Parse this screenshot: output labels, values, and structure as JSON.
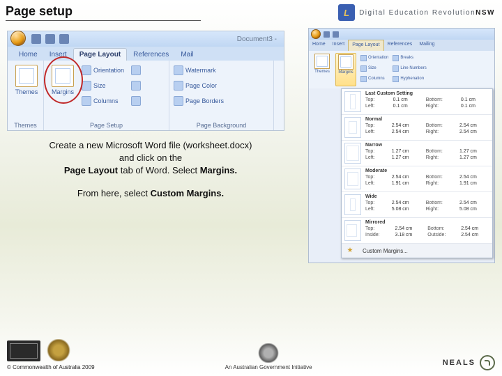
{
  "slide": {
    "title": "Page setup"
  },
  "brand": {
    "badge": "L",
    "text_plain": "Digital Education Revolution",
    "text_bold": "NSW"
  },
  "ribbon1": {
    "doc_title": "Document3 -",
    "tabs": {
      "home": "Home",
      "insert": "Insert",
      "page_layout": "Page Layout",
      "references": "References",
      "mailings": "Mail"
    },
    "themes_group": {
      "themes_btn": "Themes",
      "label": "Themes"
    },
    "page_setup_group": {
      "margins_btn": "Margins",
      "orientation": "Orientation",
      "size": "Size",
      "columns": "Columns",
      "label": "Page Setup"
    },
    "page_background_group": {
      "watermark": "Watermark",
      "page_color": "Page Color",
      "page_borders": "Page Borders",
      "label": "Page Background"
    }
  },
  "instructions": {
    "line1a": "Create a new Microsoft Word file (worksheet.docx)",
    "line1b": "and click on the",
    "line2a": "Page Layout",
    "line2b": " tab of Word. Select ",
    "line2c": "Margins.",
    "line3a": "From here, select ",
    "line3b": "Custom Margins."
  },
  "ribbon2": {
    "tabs": {
      "home": "Home",
      "insert": "Insert",
      "page_layout": "Page Layout",
      "references": "References",
      "mailings": "Mailing"
    },
    "themes_btn": "Themes",
    "margins_btn": "Margins",
    "orientation": "Orientation",
    "size": "Size",
    "columns": "Columns",
    "breaks": "Breaks",
    "line_numbers": "Line Numbers",
    "hyphenation": "Hyphenation"
  },
  "margins_menu": {
    "last": {
      "name": "Last Custom Setting",
      "top_l": "Top:",
      "top_v": "0.1 cm",
      "bot_l": "Bottom:",
      "bot_v": "0.1 cm",
      "left_l": "Left:",
      "left_v": "0.1 cm",
      "right_l": "Right:",
      "right_v": "0.1 cm"
    },
    "normal": {
      "name": "Normal",
      "top_l": "Top:",
      "top_v": "2.54 cm",
      "bot_l": "Bottom:",
      "bot_v": "2.54 cm",
      "left_l": "Left:",
      "left_v": "2.54 cm",
      "right_l": "Right:",
      "right_v": "2.54 cm"
    },
    "narrow": {
      "name": "Narrow",
      "top_l": "Top:",
      "top_v": "1.27 cm",
      "bot_l": "Bottom:",
      "bot_v": "1.27 cm",
      "left_l": "Left:",
      "left_v": "1.27 cm",
      "right_l": "Right:",
      "right_v": "1.27 cm"
    },
    "moderate": {
      "name": "Moderate",
      "top_l": "Top:",
      "top_v": "2.54 cm",
      "bot_l": "Bottom:",
      "bot_v": "2.54 cm",
      "left_l": "Left:",
      "left_v": "1.91 cm",
      "right_l": "Right:",
      "right_v": "1.91 cm"
    },
    "wide": {
      "name": "Wide",
      "top_l": "Top:",
      "top_v": "2.54 cm",
      "bot_l": "Bottom:",
      "bot_v": "2.54 cm",
      "left_l": "Left:",
      "left_v": "5.08 cm",
      "right_l": "Right:",
      "right_v": "5.08 cm"
    },
    "mirrored": {
      "name": "Mirrored",
      "top_l": "Top:",
      "top_v": "2.54 cm",
      "bot_l": "Bottom:",
      "bot_v": "2.54 cm",
      "left_l": "Inside:",
      "left_v": "3.18 cm",
      "right_l": "Outside:",
      "right_v": "2.54 cm"
    },
    "custom": "Custom Margins..."
  },
  "footer": {
    "copyright": "© Commonwealth of Australia 2009",
    "center": "An Australian Government Initiative",
    "neals": "NEALS"
  }
}
